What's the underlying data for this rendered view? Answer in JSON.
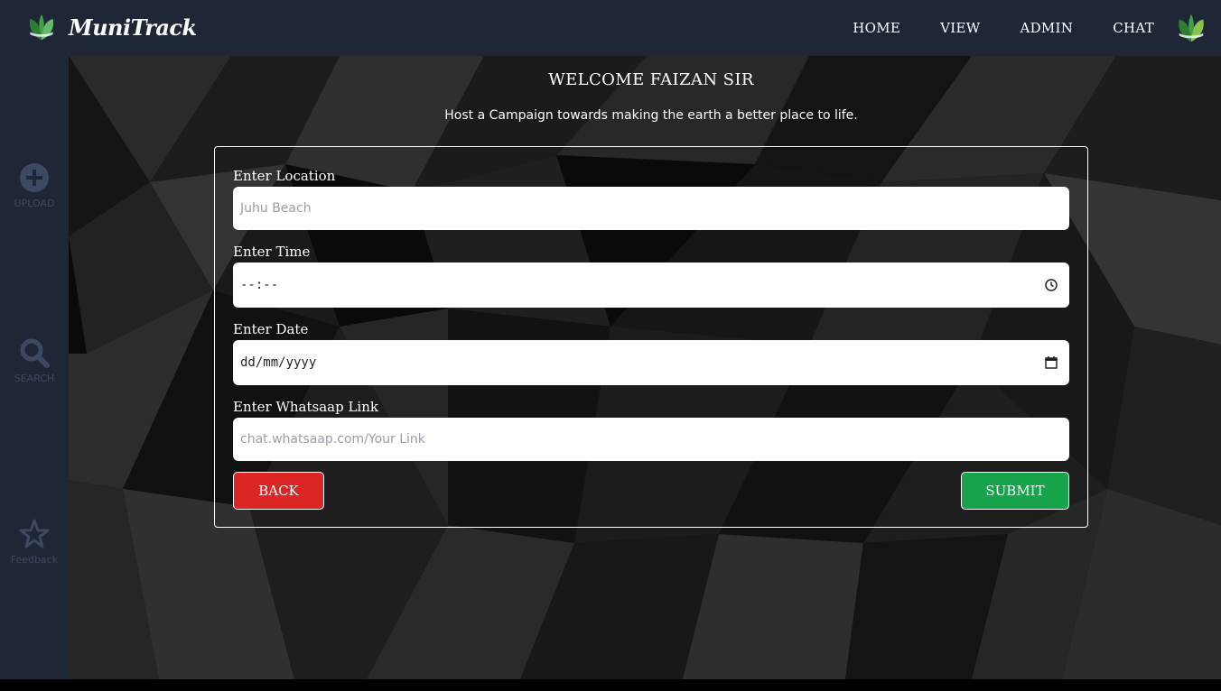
{
  "app": {
    "brand": "MuniTrack"
  },
  "nav": {
    "items": [
      "HOME",
      "VIEW",
      "ADMIN",
      "CHAT"
    ]
  },
  "sidebar": {
    "items": [
      {
        "label": "UPLOAD",
        "icon": "plus-circle-icon"
      },
      {
        "label": "SEARCH",
        "icon": "search-icon"
      },
      {
        "label": "Feedback",
        "icon": "star-icon"
      }
    ]
  },
  "main": {
    "welcome": "WELCOME FAIZAN SIR",
    "subtitle": "Host a Campaign towards making the earth a better place to life."
  },
  "form": {
    "location": {
      "label": "Enter Location",
      "placeholder": "Juhu Beach"
    },
    "time": {
      "label": "Enter Time",
      "value": "--:--"
    },
    "date": {
      "label": "Enter Date",
      "value": "dd/mm/yyyy"
    },
    "whatsapp": {
      "label": "Enter Whatsaap Link",
      "placeholder": "chat.whatsaap.com/Your Link"
    },
    "back_label": "BACK",
    "submit_label": "SUBMIT"
  },
  "colors": {
    "topbar": "#1f2737",
    "back_button": "#dc2626",
    "submit_button": "#16a34a",
    "logo_green": "#4caf50"
  }
}
